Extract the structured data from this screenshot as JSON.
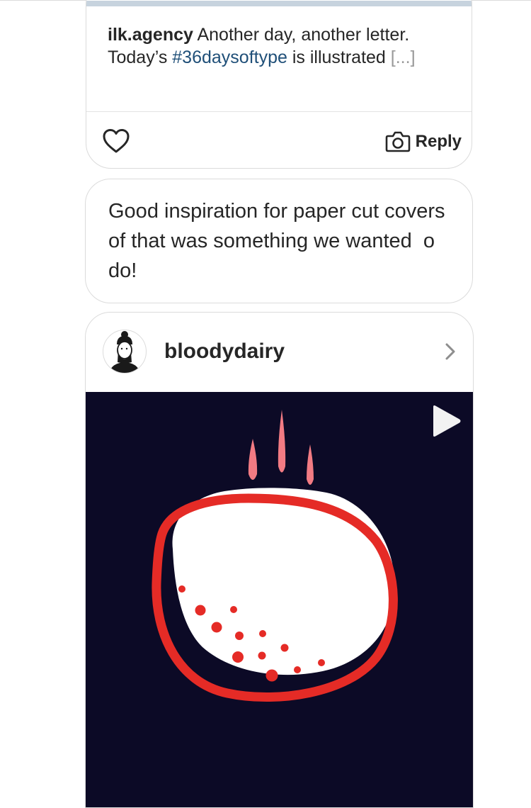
{
  "shared_post": {
    "username": "ilk.agency",
    "caption_before": " Another day, another letter. Today’s ",
    "hashtag": "#36daysoftype",
    "caption_after": " is illustrated ",
    "more": "[...]",
    "reply_label": "Reply",
    "like_icon": "heart-outline-icon",
    "camera_icon": "camera-icon"
  },
  "message": {
    "text": "Good inspiration for paper cut covers of that was something we wanted  o do!"
  },
  "post_preview": {
    "username": "bloodydairy",
    "chevron_icon": "chevron-right-icon",
    "media_type": "video",
    "play_icon": "play-icon",
    "colors": {
      "background": "#0c0a26",
      "circle": "#ffffff",
      "ring": "#e52b26",
      "drops": "#f27b83"
    }
  }
}
